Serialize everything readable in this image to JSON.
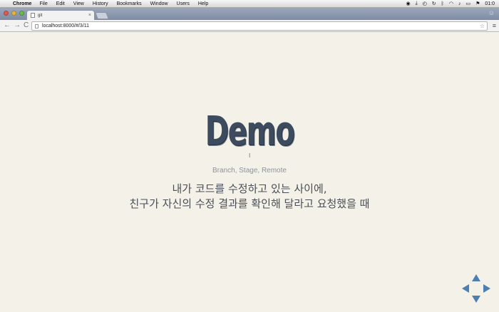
{
  "menubar": {
    "app_name": "Chrome",
    "items": [
      "File",
      "Edit",
      "View",
      "History",
      "Bookmarks",
      "Window",
      "Users",
      "Help"
    ],
    "clock": "01:0"
  },
  "tab": {
    "title": "git",
    "close": "×"
  },
  "toolbar": {
    "back": "←",
    "forward": "→",
    "reload": "C",
    "url": "localhost:8000/#/3/11",
    "star": "☆",
    "menu": "≡"
  },
  "slide": {
    "title": "Demo",
    "subtitle": "Branch, Stage, Remote",
    "line1": "내가 코드를 수정하고 있는 사이에,",
    "line2": "친구가 자신의 수정 결과를 확인해 달라고 요청했을 때"
  },
  "colors": {
    "background": "#f3f1e8",
    "title": "#3d4b5e",
    "accent": "#4d7fb0"
  },
  "icons": {
    "nav_controls": [
      "arrow-up-icon",
      "arrow-down-icon",
      "arrow-left-icon",
      "arrow-right-icon"
    ]
  }
}
